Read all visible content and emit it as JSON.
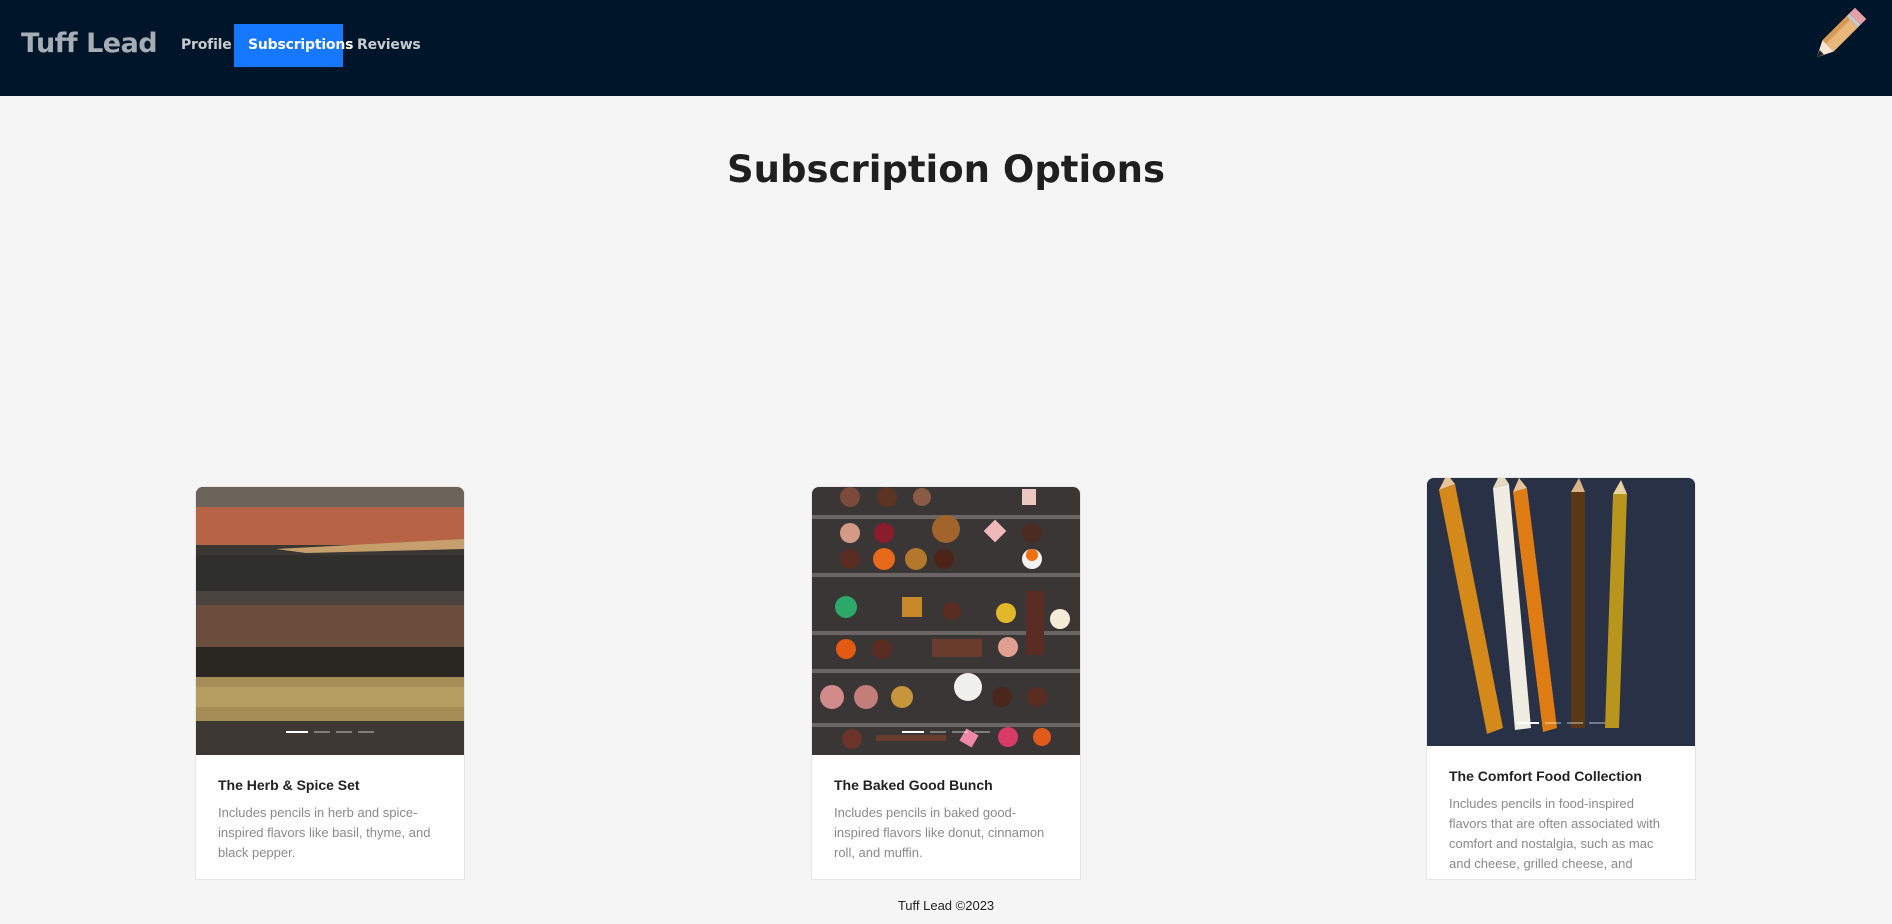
{
  "brand": {
    "name": "Tuff Lead"
  },
  "nav": {
    "items": [
      {
        "label": "Profile",
        "active": false
      },
      {
        "label": "Subscriptions",
        "active": true
      },
      {
        "label": "Reviews",
        "active": false
      }
    ],
    "active_color": "#1677ff",
    "bar_color": "#001529"
  },
  "logo_icon": "pencil-icon",
  "page": {
    "title": "Subscription Options"
  },
  "cards": [
    {
      "title": "The Herb & Spice Set",
      "description": "Includes pencils in herb and spice-inspired flavors like basil, thyme, and black pepper.",
      "image": "textured-pencils-image",
      "carousel": {
        "slides": 4,
        "active": 1
      }
    },
    {
      "title": "The Baked Good Bunch",
      "description": "Includes pencils in baked good-inspired flavors like donut, cinnamon roll, and muffin.",
      "image": "chocolate-box-image",
      "carousel": {
        "slides": 4,
        "active": 1
      }
    },
    {
      "title": "The Comfort Food Collection",
      "description": "Includes pencils in food-inspired flavors that are often associated with comfort and nostalgia, such as mac and cheese, grilled cheese, and popcorn.",
      "image": "colored-pencils-image",
      "carousel": {
        "slides": 4,
        "active": 1
      }
    }
  ],
  "footer": {
    "text": "Tuff Lead ©2023"
  }
}
